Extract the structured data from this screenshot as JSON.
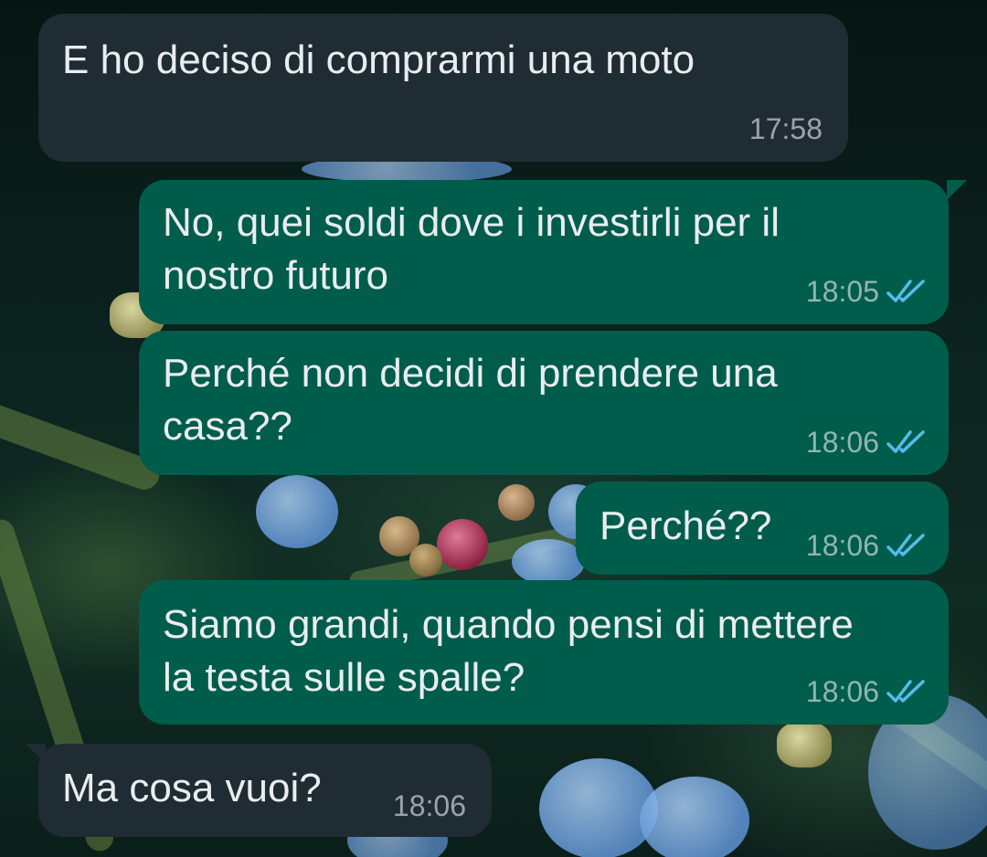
{
  "theme": {
    "incoming_bubble": "#202c33",
    "outgoing_bubble": "#005c4b",
    "read_ticks": "#53bdeb",
    "text": "#e9edef"
  },
  "messages": [
    {
      "direction": "incoming",
      "text": "E ho deciso di comprarmi una moto",
      "time": "17:58"
    },
    {
      "direction": "outgoing",
      "text": "No, quei soldi dove i investirli per il\nnostro futuro",
      "time": "18:05",
      "status": "read-double-tick-icon"
    },
    {
      "direction": "outgoing",
      "text": "Perché non decidi di prendere una\ncasa??",
      "time": "18:06",
      "status": "read-double-tick-icon"
    },
    {
      "direction": "outgoing",
      "text": "Perché??",
      "time": "18:06",
      "status": "read-double-tick-icon"
    },
    {
      "direction": "outgoing",
      "text": "Siamo grandi, quando pensi di mettere\nla testa sulle spalle?",
      "time": "18:06",
      "status": "read-double-tick-icon"
    },
    {
      "direction": "incoming",
      "text": "Ma cosa vuoi?",
      "time": "18:06"
    }
  ]
}
